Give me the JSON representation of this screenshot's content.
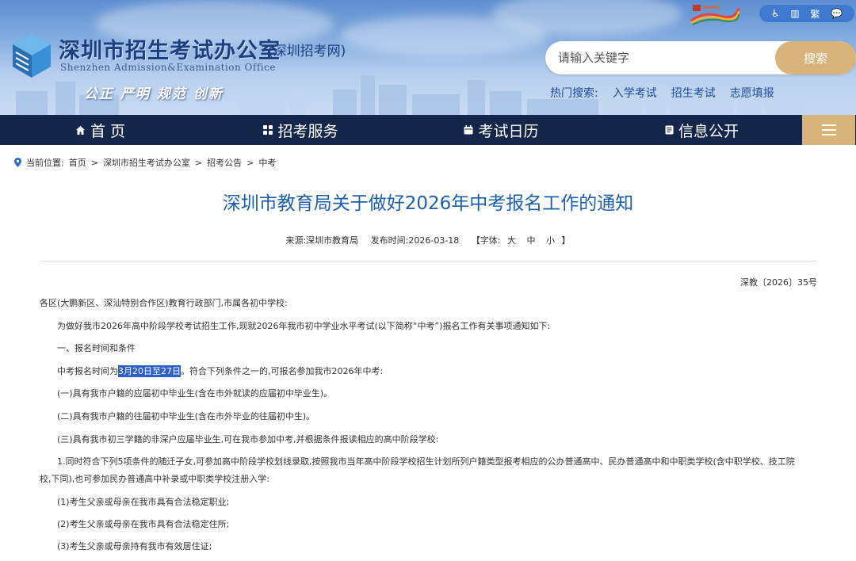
{
  "header": {
    "org_name": "深圳市招生考试办公室",
    "org_sub": "(深圳招考网)",
    "org_en": "Shenzhen Admission&Examination Office",
    "slogan": "公正 严明 规范 创新",
    "accessibility": {
      "barrier_free": "♿",
      "elder_mode": "▥",
      "traditional": "繁",
      "wechat": "💬"
    },
    "search": {
      "placeholder": "请输入关键字",
      "button": "搜索"
    },
    "hot_search": {
      "label": "热门搜索:",
      "items": [
        "入学考试",
        "招生考试",
        "志愿填报"
      ]
    }
  },
  "nav": {
    "items": [
      {
        "label": "首 页",
        "icon": "home-icon"
      },
      {
        "label": "招考服务",
        "icon": "grid-icon"
      },
      {
        "label": "考试日历",
        "icon": "calendar-icon"
      },
      {
        "label": "信息公开",
        "icon": "document-icon"
      }
    ],
    "menu_icon": "hamburger-icon"
  },
  "breadcrumb": {
    "label": "当前位置:",
    "items": [
      "首页",
      "深圳市招生考试办公室",
      "招考公告",
      "中考"
    ],
    "separator": ">"
  },
  "article": {
    "title": "深圳市教育局关于做好2026年中考报名工作的通知",
    "meta": {
      "source": "来源:深圳市教育局",
      "date": "发布时间:2026-03-18",
      "fontsize_label": "【字体:",
      "fontsize_large": "大",
      "fontsize_medium": "中",
      "fontsize_small": "小",
      "fontsize_end": "】"
    },
    "doc_number": "深教〔2026〕35号",
    "paragraphs": {
      "p1": "各区(大鹏新区、深汕特别合作区)教育行政部门,市属各初中学校:",
      "p2": "为做好我市2026年高中阶段学校考试招生工作,现就2026年我市初中学业水平考试(以下简称“中考”)报名工作有关事项通知如下:",
      "p3": "一、报名时间和条件",
      "p4_before": "中考报名时间为",
      "p4_highlight": "3月20日至27日",
      "p4_after": "。符合下列条件之一的,可报名参加我市2026年中考:",
      "p5": "(一)具有我市户籍的应届初中毕业生(含在市外就读的应届初中毕业生)。",
      "p6": "(二)具有我市户籍的往届初中毕业生(含在市外毕业的往届初中生)。",
      "p7": "(三)具有我市初三学籍的非深户应届毕业生,可在我市参加中考,并根据条件报读相应的高中阶段学校:",
      "p8a": "1.同时符合下列5项条件的随迁子女,可参加高中阶段学校划线录取,按照我市当年高中阶段学校招生计划所列户籍类型报考相应的公办普通高中、民办普通高中和中职类学校(含中职学校、技工院",
      "p8b": "校,下同),也可参加民办普通高中补录或中职类学校注册入学:",
      "p9": "(1)考生父亲或母亲在我市具有合法稳定职业;",
      "p10": "(2)考生父亲或母亲在我市具有合法稳定住所;",
      "p11": "(3)考生父亲或母亲持有我市有效居住证;"
    }
  }
}
